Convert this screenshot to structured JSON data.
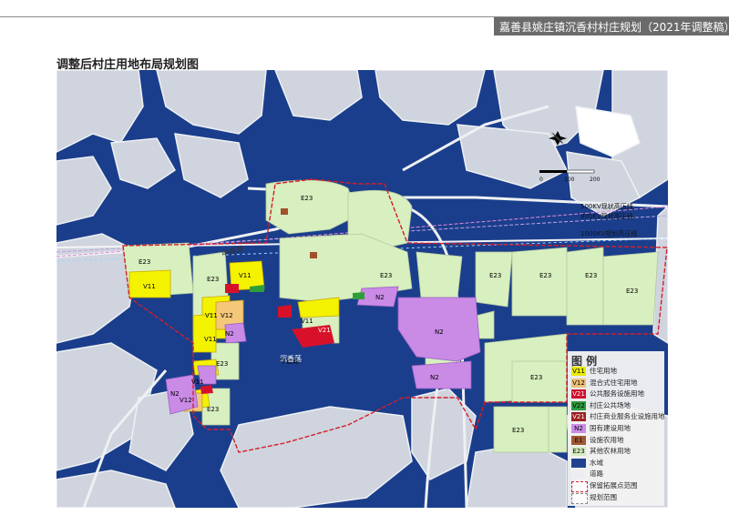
{
  "header": {
    "title": "嘉善县姚庄镇沉香村村庄规划（2021年调整稿）"
  },
  "page_title": "调整后村庄用地布局规划图",
  "colors": {
    "water": "#1a3e8c",
    "land": "#cfd4de",
    "road": "#eef0f3",
    "farm": "#d8efc0",
    "residential": "#f3f200",
    "public_service": "#d8112a",
    "state_land": "#c98be6",
    "boundary": "#d51e2a"
  },
  "map": {
    "compass": {
      "scale": [
        "0",
        "100",
        "200"
      ]
    },
    "power_lines": [
      "500KV现状高压线",
      "800KV现状高压线",
      "1000KV规划高压线"
    ],
    "road_label": "申嘉湖",
    "lake_label": "沉香荡",
    "parcels": [
      {
        "code": "E23",
        "kind": "farm"
      },
      {
        "code": "V11",
        "kind": "residential"
      },
      {
        "code": "V12",
        "kind": "mixed"
      },
      {
        "code": "V21",
        "kind": "public"
      },
      {
        "code": "V22",
        "kind": "public-space"
      },
      {
        "code": "N2",
        "kind": "state"
      },
      {
        "code": "E1",
        "kind": "facility-farm"
      }
    ]
  },
  "legend": {
    "title": "图 例",
    "items": [
      {
        "code": "V11",
        "label": "住宅用地",
        "color": "#f3f200"
      },
      {
        "code": "V12",
        "label": "混合式住宅用地",
        "color": "#f5c77a"
      },
      {
        "code": "V21",
        "label": "公共服务设施用地",
        "color": "#d8112a"
      },
      {
        "code": "V22",
        "label": "村庄公共场地",
        "color": "#2f9e3a"
      },
      {
        "code": "V21",
        "label": "村庄商业服务业设施用地",
        "color": "#9b1b1b"
      },
      {
        "code": "N2",
        "label": "国有建设用地",
        "color": "#c98be6"
      },
      {
        "code": "E1",
        "label": "设施农用地",
        "color": "#a0522d"
      },
      {
        "code": "E23",
        "label": "其他农林用地",
        "color": "#d8efc0"
      },
      {
        "code": "",
        "label": "水域",
        "color": "#1a3e8c"
      },
      {
        "code": "",
        "label": "道路",
        "color": "#eef0f3"
      },
      {
        "code": "",
        "label": "保留拓展点范围",
        "color": "#ffffff"
      },
      {
        "code": "",
        "label": "规划范围",
        "color": "#ffffff"
      }
    ]
  }
}
